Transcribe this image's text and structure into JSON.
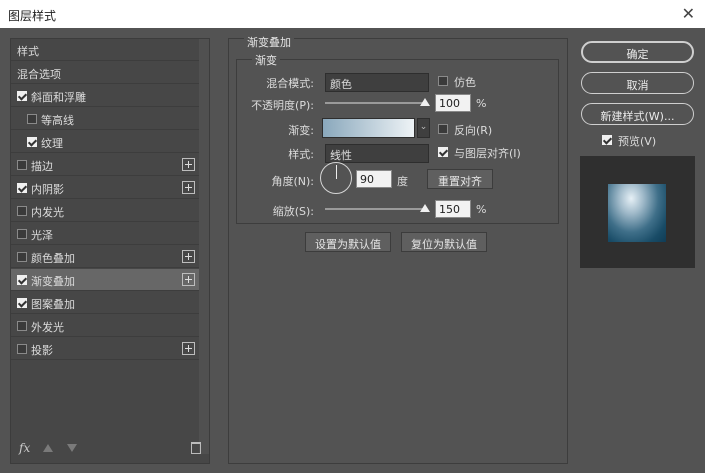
{
  "window": {
    "title": "图层样式"
  },
  "left_panel": {
    "items": [
      {
        "label": "样式",
        "checkbox": false,
        "checked": false,
        "plus": false,
        "indent": false,
        "selected": false
      },
      {
        "label": "混合选项",
        "checkbox": false,
        "checked": false,
        "plus": false,
        "indent": false,
        "selected": false
      },
      {
        "label": "斜面和浮雕",
        "checkbox": true,
        "checked": true,
        "plus": false,
        "indent": false,
        "selected": false
      },
      {
        "label": "等高线",
        "checkbox": true,
        "checked": false,
        "plus": false,
        "indent": true,
        "selected": false
      },
      {
        "label": "纹理",
        "checkbox": true,
        "checked": true,
        "plus": false,
        "indent": true,
        "selected": false
      },
      {
        "label": "描边",
        "checkbox": true,
        "checked": false,
        "plus": true,
        "indent": false,
        "selected": false
      },
      {
        "label": "内阴影",
        "checkbox": true,
        "checked": true,
        "plus": true,
        "indent": false,
        "selected": false
      },
      {
        "label": "内发光",
        "checkbox": true,
        "checked": false,
        "plus": false,
        "indent": false,
        "selected": false
      },
      {
        "label": "光泽",
        "checkbox": true,
        "checked": false,
        "plus": false,
        "indent": false,
        "selected": false
      },
      {
        "label": "颜色叠加",
        "checkbox": true,
        "checked": false,
        "plus": true,
        "indent": false,
        "selected": false
      },
      {
        "label": "渐变叠加",
        "checkbox": true,
        "checked": true,
        "plus": true,
        "indent": false,
        "selected": true
      },
      {
        "label": "图案叠加",
        "checkbox": true,
        "checked": true,
        "plus": false,
        "indent": false,
        "selected": false
      },
      {
        "label": "外发光",
        "checkbox": true,
        "checked": false,
        "plus": false,
        "indent": false,
        "selected": false
      },
      {
        "label": "投影",
        "checkbox": true,
        "checked": false,
        "plus": true,
        "indent": false,
        "selected": false
      }
    ],
    "fx_label": "fx"
  },
  "gradient_overlay": {
    "group_title": "渐变叠加",
    "subgroup_title": "渐变",
    "blend_mode_label": "混合模式:",
    "blend_mode_value": "颜色",
    "dither_label": "仿色",
    "dither_checked": false,
    "opacity_label": "不透明度(P):",
    "opacity_value": "100",
    "opacity_fraction": 1.0,
    "percent_unit": "%",
    "gradient_label": "渐变:",
    "reverse_label": "反向(R)",
    "reverse_checked": false,
    "style_label": "样式:",
    "style_value": "线性",
    "align_label": "与图层对齐(I)",
    "align_checked": true,
    "angle_label": "角度(N):",
    "angle_value": "90",
    "angle_unit": "度",
    "reset_align_label": "重置对齐",
    "scale_label": "缩放(S):",
    "scale_value": "150",
    "scale_fraction": 1.0,
    "make_default_label": "设置为默认值",
    "reset_default_label": "复位为默认值"
  },
  "right_panel": {
    "ok_label": "确定",
    "cancel_label": "取消",
    "new_style_label": "新建样式(W)...",
    "preview_label": "预览(V)",
    "preview_checked": true
  }
}
